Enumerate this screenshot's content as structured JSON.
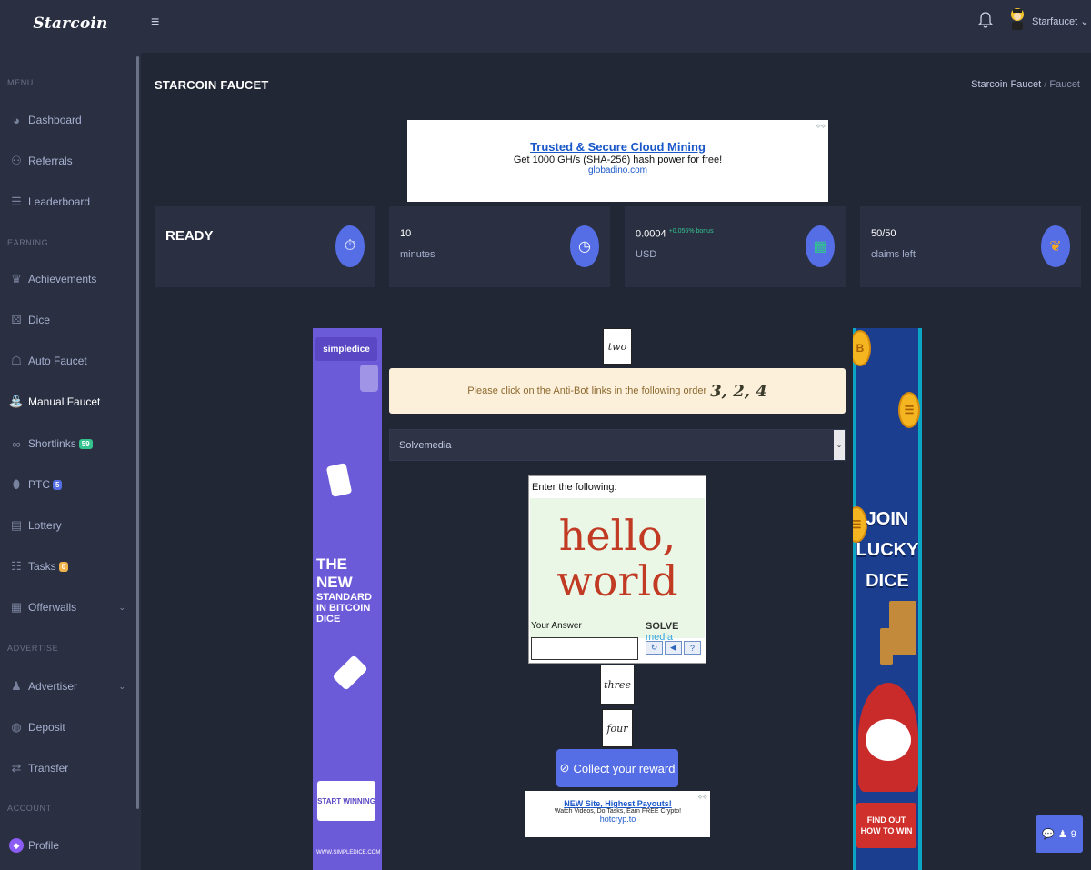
{
  "app": {
    "brand": "Starcoin"
  },
  "sidebar": {
    "sections": {
      "menu": "MENU",
      "earning": "EARNING",
      "advertise": "ADVERTISE",
      "account": "ACCOUNT"
    },
    "items": [
      {
        "label": "Dashboard",
        "icon": "dashboard-icon"
      },
      {
        "label": "Referrals",
        "icon": "users-icon"
      },
      {
        "label": "Leaderboard",
        "icon": "list-icon"
      },
      {
        "label": "Achievements",
        "icon": "trophy-icon"
      },
      {
        "label": "Dice",
        "icon": "dice-icon"
      },
      {
        "label": "Auto Faucet",
        "icon": "robot-icon"
      },
      {
        "label": "Manual Faucet",
        "icon": "faucet-icon",
        "active": true
      },
      {
        "label": "Shortlinks",
        "icon": "link-icon",
        "badge": "59",
        "badge_color": "#34c38f"
      },
      {
        "label": "PTC",
        "icon": "mouse-icon",
        "badge": "5",
        "badge_color": "#556ee6"
      },
      {
        "label": "Lottery",
        "icon": "ticket-icon"
      },
      {
        "label": "Tasks",
        "icon": "tasks-icon",
        "badge": "0",
        "badge_color": "#f1b44c"
      },
      {
        "label": "Offerwalls",
        "icon": "offerwall-icon"
      },
      {
        "label": "Advertiser",
        "icon": "advertiser-icon"
      },
      {
        "label": "Deposit",
        "icon": "deposit-icon"
      },
      {
        "label": "Transfer",
        "icon": "transfer-icon"
      },
      {
        "label": "Profile",
        "icon": "profile-icon"
      }
    ]
  },
  "topbar": {
    "username": "Starfaucet"
  },
  "page": {
    "title": "STARCOIN FAUCET",
    "breadcrumb": [
      "Starcoin Faucet",
      "Faucet"
    ]
  },
  "ad_top": {
    "headline": "Trusted & Secure Cloud Mining",
    "body": "Get 1000 GH/s (SHA-256) hash power for free!",
    "domain": "globadino.com"
  },
  "stats": [
    {
      "value": "READY",
      "sub": ""
    },
    {
      "value": "10",
      "sub": "minutes"
    },
    {
      "value": "0.0004",
      "bonus": "+0.056% bonus",
      "sub": "USD"
    },
    {
      "value": "50/50",
      "sub": "claims left"
    }
  ],
  "ad_left": {
    "logo": "simpledice",
    "headline_big": "THE NEW",
    "headline_rest": "STANDARD IN BITCOIN DICE",
    "cta": "START WINNING",
    "footer": "WWW.SIMPLEDICE.COM"
  },
  "ad_right": {
    "headline": "JOIN LUCKY DICE",
    "cta": "FIND OUT HOW TO WIN"
  },
  "antibot": {
    "instruction": "Please click on the Anti-Bot links in the following order",
    "order": "3, 2, 4",
    "words": [
      "two",
      "three",
      "four"
    ]
  },
  "captcha": {
    "selected_provider": "Solvemedia",
    "prompt": "Enter the following:",
    "challenge": "hello, world",
    "answer_label": "Your Answer",
    "brand_solve": "SOLVE",
    "brand_media": "media",
    "answer_value": ""
  },
  "collect_button": "Collect your reward",
  "ad_bottom": {
    "headline": "NEW Site, Highest Payouts!",
    "body": "Watch Videos, Do Tasks, Earn FREE Crypto!",
    "domain": "hotcryp.to"
  },
  "chat_widget": {
    "count": "9"
  },
  "colors": {
    "accent": "#556ee6",
    "success": "#34c38f",
    "warning": "#f1b44c",
    "sidebar": "#2a3042",
    "background": "#222736"
  }
}
